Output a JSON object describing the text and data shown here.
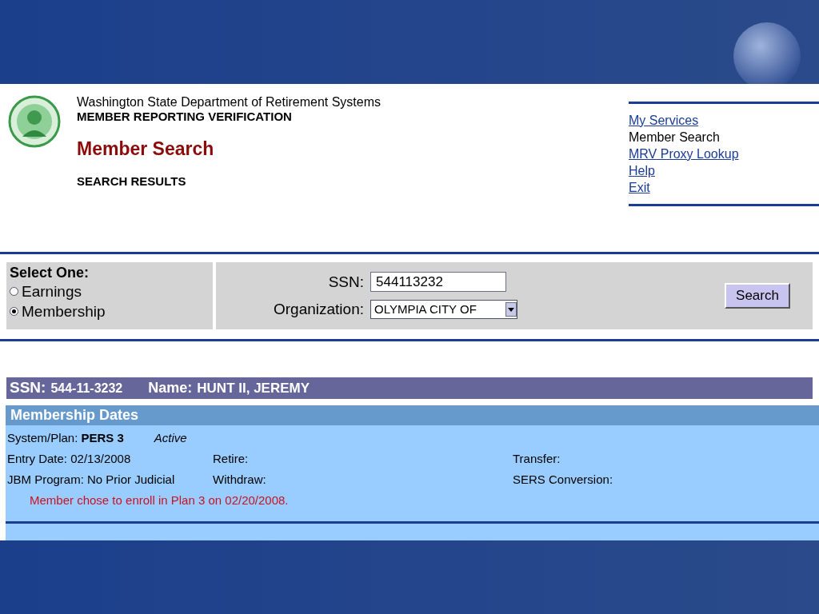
{
  "header": {
    "agency": "Washington State Department of Retirement Systems",
    "system": "MEMBER REPORTING VERIFICATION",
    "page_title": "Member Search",
    "subtitle": "SEARCH RESULTS"
  },
  "nav": [
    {
      "label": "My Services",
      "kind": "link"
    },
    {
      "label": "Member Search",
      "kind": "current"
    },
    {
      "label": "MRV Proxy Lookup",
      "kind": "link"
    },
    {
      "label": "Help",
      "kind": "link"
    },
    {
      "label": "Exit",
      "kind": "link"
    }
  ],
  "search_form": {
    "select_label": "Select One:",
    "options": [
      {
        "label": "Earnings",
        "selected": false
      },
      {
        "label": "Membership",
        "selected": true
      }
    ],
    "ssn_label": "SSN:",
    "ssn_value": "544113232",
    "org_label": "Organization:",
    "org_value": "OLYMPIA CITY OF",
    "button": "Search"
  },
  "result": {
    "ssn_label": "SSN:",
    "ssn": "544-11-3232",
    "name_label": "Name:",
    "name": "HUNT II, JEREMY"
  },
  "membership": {
    "title": "Membership Dates",
    "plan_label": "System/Plan:",
    "plan": "PERS 3",
    "status": "Active",
    "fields": [
      {
        "label": "Entry Date:",
        "value": "02/13/2008"
      },
      {
        "label": "Retire:"
      },
      {
        "label": "Transfer:"
      },
      {
        "label": "JBM Program:",
        "value": "No Prior Judicial"
      },
      {
        "label": "Withdraw:"
      },
      {
        "label": "SERS Conversion:"
      }
    ],
    "note": "Member chose to enroll in Plan 3 on 02/20/2008."
  }
}
